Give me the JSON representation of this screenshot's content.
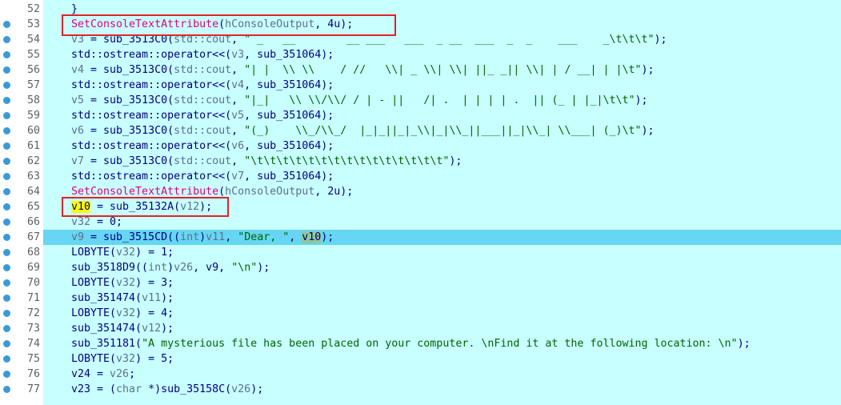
{
  "lines": [
    {
      "no": "52",
      "code": "}"
    },
    {
      "no": "53",
      "parts": [
        [
          "api",
          "SetConsoleTextAttribute"
        ],
        [
          "fn",
          "("
        ],
        [
          "var",
          "hConsoleOutput"
        ],
        [
          "fn",
          ", 4u);"
        ]
      ]
    },
    {
      "no": "54",
      "parts": [
        [
          "var",
          "v3"
        ],
        [
          "fn",
          " = sub_3513C0("
        ],
        [
          "var",
          "std::cout"
        ],
        [
          "fn",
          ", "
        ],
        [
          "str",
          "\" _   __        __ ___   ___  _ __  ___  _  _    ___    _\\t\\t\\t\""
        ],
        [
          "fn",
          ");"
        ]
      ]
    },
    {
      "no": "55",
      "parts": [
        [
          "fn",
          "std::ostream::operator<<("
        ],
        [
          "var",
          "v3"
        ],
        [
          "fn",
          ", sub_351064);"
        ]
      ]
    },
    {
      "no": "56",
      "parts": [
        [
          "var",
          "v4"
        ],
        [
          "fn",
          " = sub_3513C0("
        ],
        [
          "var",
          "std::cout"
        ],
        [
          "fn",
          ", "
        ],
        [
          "str",
          "\"| |  \\\\ \\\\    / //   \\\\| _ \\\\| \\\\| ||_ _|| \\\\| | / __| | |\\t\""
        ],
        [
          "fn",
          ");"
        ]
      ]
    },
    {
      "no": "57",
      "parts": [
        [
          "fn",
          "std::ostream::operator<<("
        ],
        [
          "var",
          "v4"
        ],
        [
          "fn",
          ", sub_351064);"
        ]
      ]
    },
    {
      "no": "58",
      "parts": [
        [
          "var",
          "v5"
        ],
        [
          "fn",
          " = sub_3513C0("
        ],
        [
          "var",
          "std::cout"
        ],
        [
          "fn",
          ", "
        ],
        [
          "str",
          "\"|_|   \\\\ \\\\/\\\\/ / | - ||   /| .  | | | | .  || (_ | |_|\\t\\t\""
        ],
        [
          "fn",
          ");"
        ]
      ]
    },
    {
      "no": "59",
      "parts": [
        [
          "fn",
          "std::ostream::operator<<("
        ],
        [
          "var",
          "v5"
        ],
        [
          "fn",
          ", sub_351064);"
        ]
      ]
    },
    {
      "no": "60",
      "parts": [
        [
          "var",
          "v6"
        ],
        [
          "fn",
          " = sub_3513C0("
        ],
        [
          "var",
          "std::cout"
        ],
        [
          "fn",
          ", "
        ],
        [
          "str",
          "\"(_)    \\\\_/\\\\_/  |_|_||_|_\\\\|_|\\\\_||___||_|\\\\_| \\\\___| (_)\\t\""
        ],
        [
          "fn",
          ");"
        ]
      ]
    },
    {
      "no": "61",
      "parts": [
        [
          "fn",
          "std::ostream::operator<<("
        ],
        [
          "var",
          "v6"
        ],
        [
          "fn",
          ", sub_351064);"
        ]
      ]
    },
    {
      "no": "62",
      "parts": [
        [
          "var",
          "v7"
        ],
        [
          "fn",
          " = sub_3513C0("
        ],
        [
          "var",
          "std::cout"
        ],
        [
          "fn",
          ", "
        ],
        [
          "str",
          "\"\\t\\t\\t\\t\\t\\t\\t\\t\\t\\t\\t\\t\\t\\t\\t\""
        ],
        [
          "fn",
          ");"
        ]
      ]
    },
    {
      "no": "63",
      "parts": [
        [
          "fn",
          "std::ostream::operator<<("
        ],
        [
          "var",
          "v7"
        ],
        [
          "fn",
          ", sub_351064);"
        ]
      ]
    },
    {
      "no": "64",
      "parts": [
        [
          "api",
          "SetConsoleTextAttribute"
        ],
        [
          "fn",
          "("
        ],
        [
          "var",
          "hConsoleOutput"
        ],
        [
          "fn",
          ", 2u);"
        ]
      ]
    },
    {
      "no": "65",
      "parts": [
        [
          "ybox",
          "v10"
        ],
        [
          "fn",
          " = sub_35132A("
        ],
        [
          "var",
          "v12"
        ],
        [
          "fn",
          ");"
        ]
      ]
    },
    {
      "no": "66",
      "parts": [
        [
          "var",
          "v32"
        ],
        [
          "fn",
          " = 0;"
        ]
      ]
    },
    {
      "no": "67",
      "hl": true,
      "parts": [
        [
          "var",
          "v9"
        ],
        [
          "fn",
          " = sub_3515CD(("
        ],
        [
          "kw",
          "int"
        ],
        [
          "fn",
          ")"
        ],
        [
          "var",
          "v11"
        ],
        [
          "fn",
          ", "
        ],
        [
          "str",
          "\"Dear, \""
        ],
        [
          "fn",
          ", "
        ],
        [
          "gbox",
          "v10"
        ],
        [
          "fn",
          ");"
        ]
      ]
    },
    {
      "no": "68",
      "parts": [
        [
          "fn",
          "LOBYTE("
        ],
        [
          "var",
          "v32"
        ],
        [
          "fn",
          ") = 1;"
        ]
      ]
    },
    {
      "no": "69",
      "parts": [
        [
          "fn",
          "sub_3518D9(("
        ],
        [
          "kw",
          "int"
        ],
        [
          "fn",
          ")"
        ],
        [
          "var",
          "v26"
        ],
        [
          "fn",
          ", v9, "
        ],
        [
          "str",
          "\"\\n\""
        ],
        [
          "fn",
          ");"
        ]
      ]
    },
    {
      "no": "70",
      "parts": [
        [
          "fn",
          "LOBYTE("
        ],
        [
          "var",
          "v32"
        ],
        [
          "fn",
          ") = 3;"
        ]
      ]
    },
    {
      "no": "71",
      "parts": [
        [
          "fn",
          "sub_351474("
        ],
        [
          "var",
          "v11"
        ],
        [
          "fn",
          ");"
        ]
      ]
    },
    {
      "no": "72",
      "parts": [
        [
          "fn",
          "LOBYTE("
        ],
        [
          "var",
          "v32"
        ],
        [
          "fn",
          ") = 4;"
        ]
      ]
    },
    {
      "no": "73",
      "parts": [
        [
          "fn",
          "sub_351474("
        ],
        [
          "var",
          "v12"
        ],
        [
          "fn",
          ");"
        ]
      ]
    },
    {
      "no": "74",
      "parts": [
        [
          "fn",
          "sub_351181("
        ],
        [
          "str",
          "\"A mysterious file has been placed on your computer. \\nFind it at the following location: \\n\""
        ],
        [
          "fn",
          ");"
        ]
      ]
    },
    {
      "no": "75",
      "parts": [
        [
          "fn",
          "LOBYTE("
        ],
        [
          "var",
          "v32"
        ],
        [
          "fn",
          ") = 5;"
        ]
      ]
    },
    {
      "no": "76",
      "parts": [
        [
          "fn",
          "v24 = "
        ],
        [
          "var",
          "v26"
        ],
        [
          "fn",
          ";"
        ]
      ]
    },
    {
      "no": "77",
      "parts": [
        [
          "fn",
          "v23 = ("
        ],
        [
          "kw",
          "char"
        ],
        [
          "fn",
          " *)sub_35158C("
        ],
        [
          "var",
          "v26"
        ],
        [
          "fn",
          ");"
        ]
      ]
    }
  ],
  "colors": {
    "background": "#c8ffff",
    "highlight": "#66d6f2",
    "annotation": "#e0242a"
  }
}
